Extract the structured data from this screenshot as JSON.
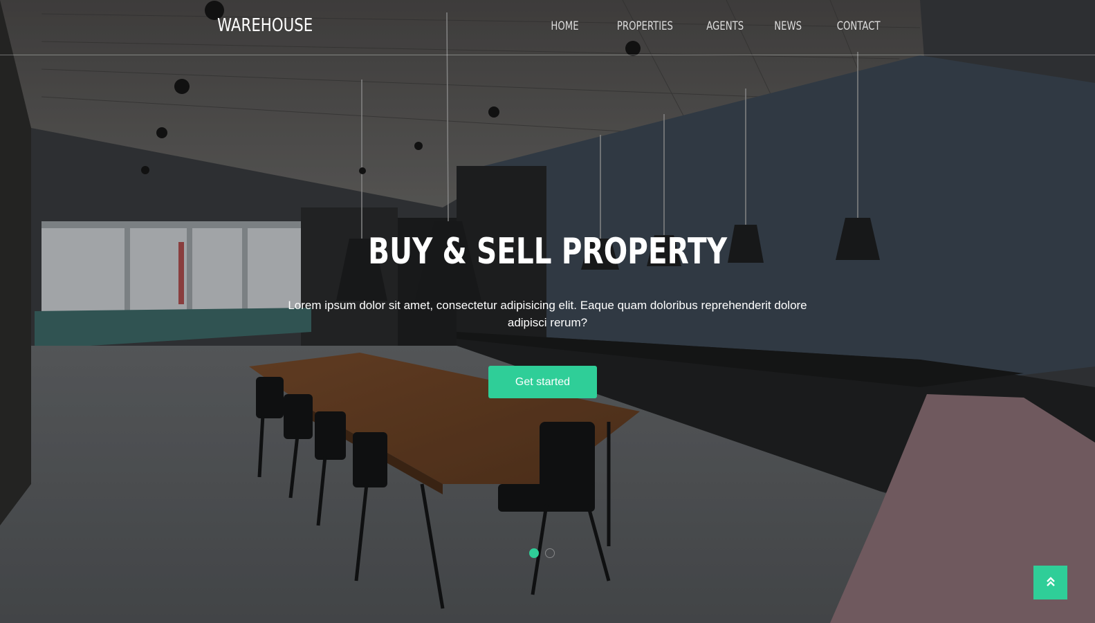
{
  "site": {
    "brand": "WAREHOUSE"
  },
  "nav": [
    {
      "label": "HOME"
    },
    {
      "label": "PROPERTIES"
    },
    {
      "label": "AGENTS"
    },
    {
      "label": "NEWS"
    },
    {
      "label": "CONTACT"
    }
  ],
  "hero": {
    "title": "BUY & SELL PROPERTY",
    "text": "Lorem ipsum dolor sit amet, consectetur adipisicing elit. Eaque quam doloribus reprehenderit dolore adipisci rerum?",
    "cta_label": "Get started"
  },
  "slider": {
    "slide_count": 2,
    "active_index": 0
  },
  "scroll_top": {
    "icon": "double-chevron-up-icon"
  },
  "colors": {
    "accent": "#2fce98",
    "wall": "#3f4b57",
    "table": "#8b5a34",
    "bench": "#b8949c"
  }
}
